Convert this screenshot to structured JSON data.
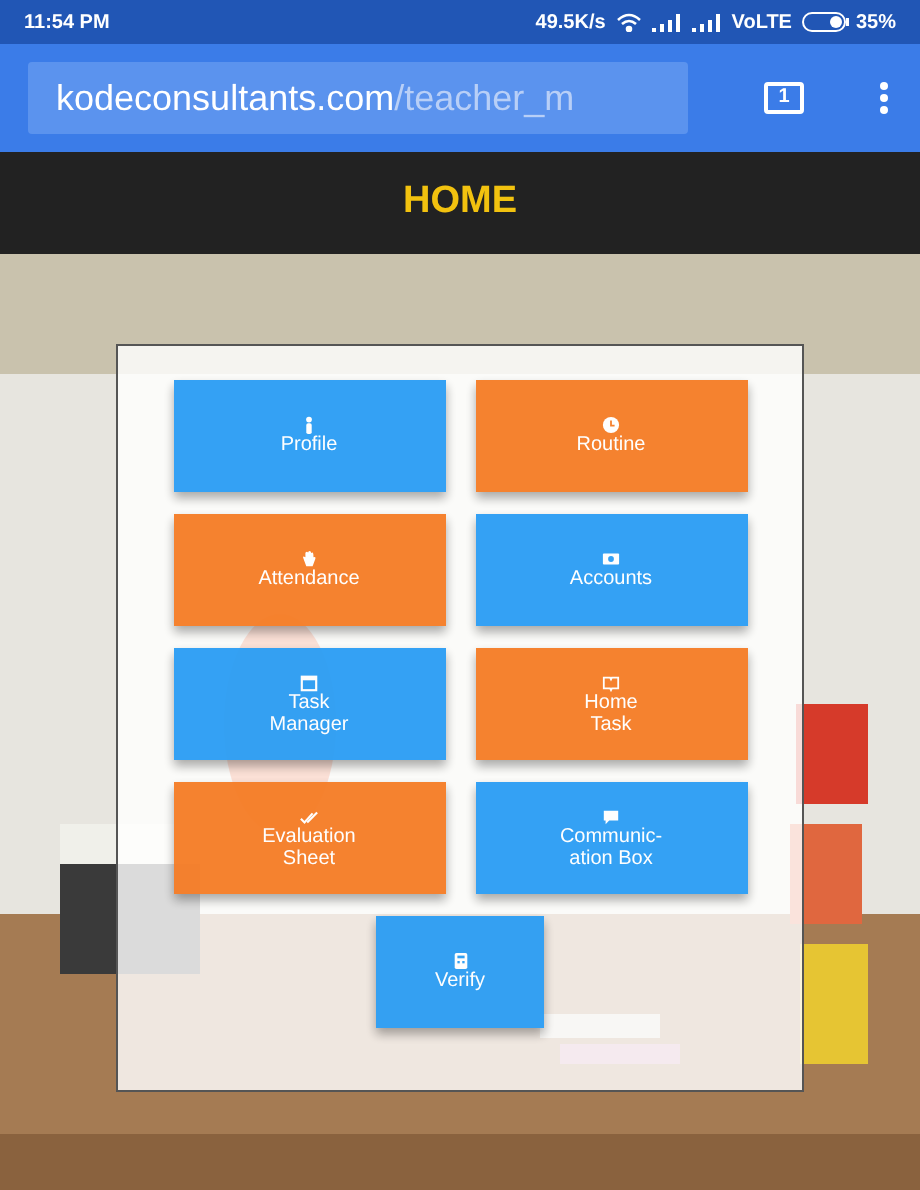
{
  "status_bar": {
    "time": "11:54 PM",
    "speed": "49.5K/s",
    "network": "VoLTE",
    "battery": "35%"
  },
  "browser": {
    "url_host": "kodeconsultants.com",
    "url_path": "/teacher_m",
    "tab_count": "1"
  },
  "header": {
    "title": "HOME"
  },
  "tiles": [
    {
      "lines": [
        "Profile"
      ],
      "color": "#2a9df4"
    },
    {
      "lines": [
        "Routine"
      ],
      "color": "#f57c25"
    },
    {
      "lines": [
        "Attendance"
      ],
      "color": "#f57c25"
    },
    {
      "lines": [
        "Accounts"
      ],
      "color": "#2a9df4"
    },
    {
      "lines": [
        "Task",
        "Manager"
      ],
      "color": "#2a9df4"
    },
    {
      "lines": [
        "Home",
        "Task"
      ],
      "color": "#f57c25"
    },
    {
      "lines": [
        "Evaluation",
        "Sheet"
      ],
      "color": "#f57c25"
    },
    {
      "lines": [
        "Communic-",
        "ation Box"
      ],
      "color": "#2a9df4"
    },
    {
      "lines": [
        "Verify"
      ],
      "color": "#2a9df4"
    }
  ]
}
